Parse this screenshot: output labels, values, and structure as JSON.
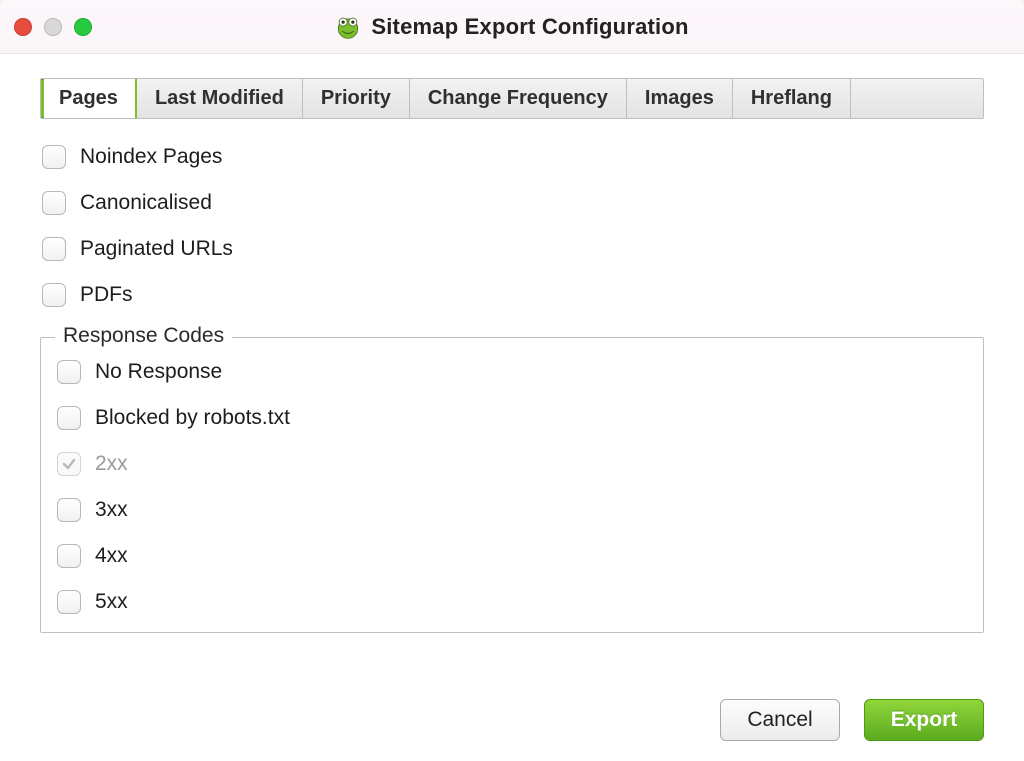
{
  "window": {
    "title": "Sitemap Export Configuration"
  },
  "tabs": [
    {
      "label": "Pages",
      "active": true
    },
    {
      "label": "Last Modified",
      "active": false
    },
    {
      "label": "Priority",
      "active": false
    },
    {
      "label": "Change Frequency",
      "active": false
    },
    {
      "label": "Images",
      "active": false
    },
    {
      "label": "Hreflang",
      "active": false
    }
  ],
  "page_options": [
    {
      "label": "Noindex Pages",
      "checked": false
    },
    {
      "label": "Canonicalised",
      "checked": false
    },
    {
      "label": "Paginated URLs",
      "checked": false
    },
    {
      "label": "PDFs",
      "checked": false
    }
  ],
  "response_codes": {
    "legend": "Response Codes",
    "items": [
      {
        "label": "No Response",
        "checked": false,
        "disabled": false
      },
      {
        "label": "Blocked by robots.txt",
        "checked": false,
        "disabled": false
      },
      {
        "label": "2xx",
        "checked": true,
        "disabled": true
      },
      {
        "label": "3xx",
        "checked": false,
        "disabled": false
      },
      {
        "label": "4xx",
        "checked": false,
        "disabled": false
      },
      {
        "label": "5xx",
        "checked": false,
        "disabled": false
      }
    ]
  },
  "footer": {
    "cancel_label": "Cancel",
    "export_label": "Export"
  }
}
